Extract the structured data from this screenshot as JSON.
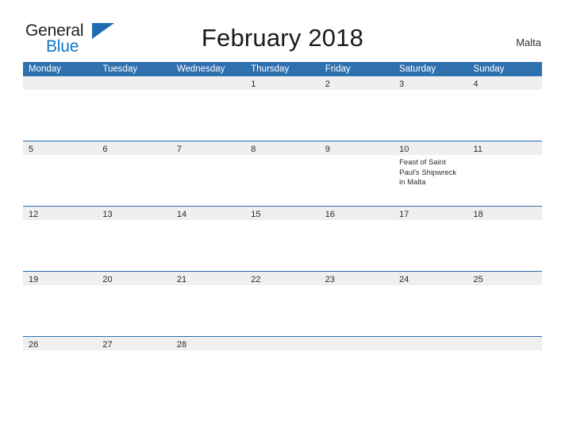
{
  "brand": {
    "name_part1": "General",
    "name_part2": "Blue",
    "flag_icon": "blue-flag-triangle"
  },
  "header": {
    "title": "February 2018",
    "region": "Malta"
  },
  "calendar": {
    "month": "February",
    "year": "2018",
    "weekday_headers": [
      "Monday",
      "Tuesday",
      "Wednesday",
      "Thursday",
      "Friday",
      "Saturday",
      "Sunday"
    ],
    "weeks": [
      {
        "days": [
          {
            "number": "",
            "events": []
          },
          {
            "number": "",
            "events": []
          },
          {
            "number": "",
            "events": []
          },
          {
            "number": "1",
            "events": []
          },
          {
            "number": "2",
            "events": []
          },
          {
            "number": "3",
            "events": []
          },
          {
            "number": "4",
            "events": []
          }
        ]
      },
      {
        "days": [
          {
            "number": "5",
            "events": []
          },
          {
            "number": "6",
            "events": []
          },
          {
            "number": "7",
            "events": []
          },
          {
            "number": "8",
            "events": []
          },
          {
            "number": "9",
            "events": []
          },
          {
            "number": "10",
            "events": [
              "Feast of Saint Paul's Shipwreck in Malta"
            ]
          },
          {
            "number": "11",
            "events": []
          }
        ]
      },
      {
        "days": [
          {
            "number": "12",
            "events": []
          },
          {
            "number": "13",
            "events": []
          },
          {
            "number": "14",
            "events": []
          },
          {
            "number": "15",
            "events": []
          },
          {
            "number": "16",
            "events": []
          },
          {
            "number": "17",
            "events": []
          },
          {
            "number": "18",
            "events": []
          }
        ]
      },
      {
        "days": [
          {
            "number": "19",
            "events": []
          },
          {
            "number": "20",
            "events": []
          },
          {
            "number": "21",
            "events": []
          },
          {
            "number": "22",
            "events": []
          },
          {
            "number": "23",
            "events": []
          },
          {
            "number": "24",
            "events": []
          },
          {
            "number": "25",
            "events": []
          }
        ]
      },
      {
        "days": [
          {
            "number": "26",
            "events": []
          },
          {
            "number": "27",
            "events": []
          },
          {
            "number": "28",
            "events": []
          },
          {
            "number": "",
            "events": []
          },
          {
            "number": "",
            "events": []
          },
          {
            "number": "",
            "events": []
          },
          {
            "number": "",
            "events": []
          }
        ]
      }
    ]
  },
  "colors": {
    "header_blue": "#2f70af",
    "brand_blue": "#1275c4",
    "day_band_grey": "#efefef",
    "text_dark": "#2b2b2b"
  }
}
